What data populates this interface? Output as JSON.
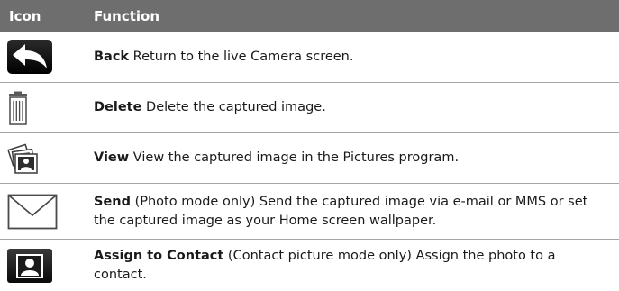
{
  "header": {
    "icon_col": "Icon",
    "function_col": "Function"
  },
  "rows": [
    {
      "icon": "back-arrow-icon",
      "term": "Back",
      "description": "  Return to the live Camera screen."
    },
    {
      "icon": "trash-bin-icon",
      "term": "Delete",
      "description": "  Delete the captured image."
    },
    {
      "icon": "photo-stack-icon",
      "term": "View",
      "description": "  View the captured image in the Pictures program."
    },
    {
      "icon": "envelope-icon",
      "term": "Send",
      "description": " (Photo mode only)  Send the captured image via e-mail or MMS or set the captured image as your Home screen wallpaper."
    },
    {
      "icon": "contact-portrait-icon",
      "term": "Assign to Contact",
      "description": " (Contact picture mode only)  Assign the photo to a contact."
    }
  ]
}
